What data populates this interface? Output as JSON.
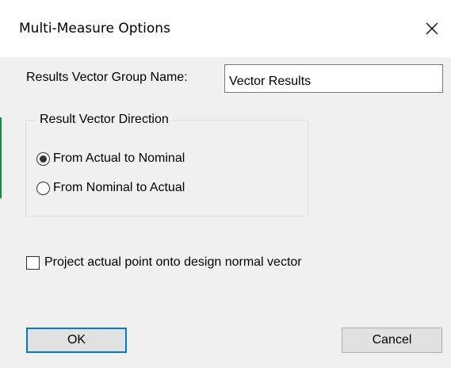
{
  "dialog": {
    "title": "Multi-Measure Options",
    "close_icon": "close-icon"
  },
  "form": {
    "group_name_label": "Results Vector Group Name:",
    "group_name_value": "Vector Results"
  },
  "direction_group": {
    "legend": "Result Vector Direction",
    "options": [
      {
        "label": "From Actual to Nominal",
        "selected": true
      },
      {
        "label": "From Nominal to Actual",
        "selected": false
      }
    ]
  },
  "project_option": {
    "label": "Project actual point onto design normal vector",
    "checked": false
  },
  "buttons": {
    "ok": "OK",
    "cancel": "Cancel"
  },
  "colors": {
    "focus_border": "#0078d7",
    "dialog_background": "#f0f0f0"
  }
}
